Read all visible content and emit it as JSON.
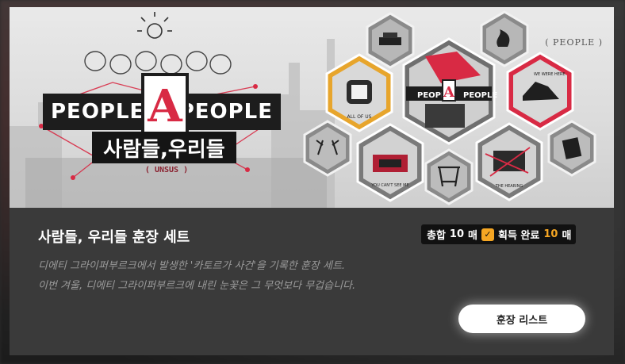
{
  "banner": {
    "logo_left": "PEOPLE",
    "logo_a": "A",
    "logo_right": "PEOPLE",
    "logo_korean": "사람들,우리들",
    "logo_sub": "( UNSUS )",
    "doc_title": "( PEOPLE )",
    "badges": [
      {
        "name": "hat-badge",
        "label": ""
      },
      {
        "name": "smoke-badge",
        "label": ""
      },
      {
        "name": "fist-badge",
        "label": "ALL OF US"
      },
      {
        "name": "people-a-people-badge",
        "label": "PEOPLE A PEOPLE"
      },
      {
        "name": "shoe-badge",
        "label": "WE WERE HERE"
      },
      {
        "name": "antler-badge",
        "label": ""
      },
      {
        "name": "lock-badge",
        "label": "YOU CAN'T SEE ME"
      },
      {
        "name": "swing-badge",
        "label": ""
      },
      {
        "name": "red-thread-badge",
        "label": "THE HEARING"
      },
      {
        "name": "document-badge",
        "label": ""
      }
    ]
  },
  "set": {
    "title": "사람들, 우리들 훈장 세트",
    "total_label": "총합",
    "total_count": "10",
    "unit": "매",
    "acquired_label": "획득 완료",
    "acquired_count": "10",
    "desc_line1": "디에티 그라이퍼부르크에서 발생한 '카토르가 사건'을 기록한 훈장 세트.",
    "desc_line2": "이번 겨울, 디에티 그라이퍼부르크에 내린 눈꽃은 그 무엇보다 무겁습니다.",
    "list_button": "훈장 리스트"
  },
  "colors": {
    "accent_gold": "#f5a623",
    "accent_red": "#d82a44",
    "panel_bg": "#3a3a3a"
  }
}
